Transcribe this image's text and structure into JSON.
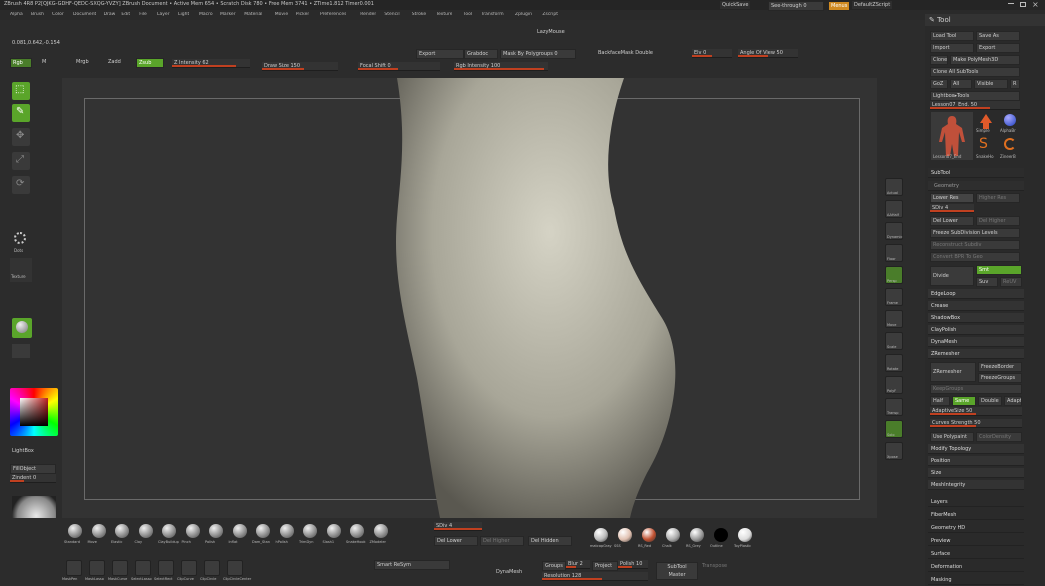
{
  "app": {
    "title": "ZBrush 4R8 P2[QJKG-GDHF-QEDC-SXQG-YVZY]  ZBrush Document   • Active Mem 654 • Scratch Disk 780 • Free Mem 3741 • ZTime1.812 Timer0.001",
    "quicksave": "QuickSave",
    "see_through": "See-through 0",
    "menus_btn": "Menus",
    "script": "DefaultZScript"
  },
  "menus": [
    "Alpha",
    "Brush",
    "Color",
    "Document",
    "Draw",
    "Edit",
    "File",
    "Layer",
    "Light",
    "Macro",
    "Marker",
    "Material",
    "Movie",
    "Picker",
    "Preferences",
    "Render",
    "Stencil",
    "Stroke",
    "Texture",
    "Tool",
    "Transform",
    "Zplugin",
    "Zscript"
  ],
  "coords": "0.081,0.642,-0.154",
  "toolbar": {
    "lazymouse": "LazyMouse",
    "export": "Export",
    "grabdoc": "Grabdoc",
    "mask_by_polygroups": "Mask By Polygroups 0",
    "backfacemask": "BackfaceMask Double",
    "elv": "Elv 0",
    "angle_of_view": "Angle Of View 50",
    "rgb": "Rgb",
    "m": "M",
    "mrgb": "Mrgb",
    "zadd": "Zadd",
    "zsub": "Zsub",
    "zcut": "Zcut",
    "z_intensity": "Z Intensity 62",
    "draw_size": "Draw Size 150",
    "focal_shift": "Focal Shift 0",
    "rgb_intensity": "Rgb Intensity 100"
  },
  "left_tools": [
    {
      "label": "Edit"
    },
    {
      "label": "Draw"
    },
    {
      "label": "Move"
    },
    {
      "label": "Scale"
    },
    {
      "label": "Rotate"
    }
  ],
  "left_panel": {
    "dots": "Dots",
    "texture": "Texture",
    "gold": "Gold",
    "lightbox": "LightBox",
    "fill_object": "FillObject",
    "zindent": "Zindent 0",
    "alpha": "Alpha"
  },
  "right_tool": {
    "header": "Tool",
    "load_tool": "Load Tool",
    "save_as": "Save As",
    "import": "Import",
    "export": "Export",
    "clone": "Clone",
    "make_polymesh": "Make PolyMesh3D",
    "clone_all": "Clone All SubTools",
    "goz": "GoZ",
    "all": "All",
    "visible": "Visible",
    "r": "R",
    "lightbox_tools": "Lightbox▸Tools",
    "tool_name": "Lesson07_End. 50",
    "thumb_labels": [
      "Lesson07_End",
      "Simple",
      "AlphaBr",
      "SnakeHo",
      "ZineerB"
    ],
    "subtool": "SubTool",
    "geometry": "Geometry",
    "lower_res": "Lower Res",
    "higher_res": "Higher Res",
    "sdiv": "SDiv 4",
    "del_lower": "Del Lower",
    "del_higher": "Del Higher",
    "freeze_subdiv": "Freeze SubDivision Levels",
    "reconstruct": "Reconstruct Subdiv",
    "convert_bpr": "Convert BPR To Geo",
    "divide": "Divide",
    "smt": "Smt",
    "suv": "Suv",
    "reuv": "ReUV",
    "edgeloop": "EdgeLoop",
    "crease": "Crease",
    "shadowbox": "ShadowBox",
    "claypolish": "ClayPolish",
    "dynamesh": "DynaMesh",
    "zremesher": "ZRemesher",
    "zremesher_btn": "ZRemesher",
    "freeze_border": "FreezeBorder",
    "freeze_groups": "FreezeGroups",
    "keep_groups": "KeepGroups",
    "half": "Half",
    "same": "Same",
    "double": "Double",
    "adapt": "Adapt",
    "adaptive_size": "AdaptiveSize 50",
    "curves_strength": "Curves Strength 50",
    "use_polypaint": "Use Polypaint",
    "color_density": "ColorDensity",
    "modify_topology": "Modify Topology",
    "position": "Position",
    "size": "Size",
    "mesh_integrity": "MeshIntegrity",
    "layers": "Layers",
    "fibermesh": "FiberMesh",
    "geometry_hd": "Geometry HD",
    "preview": "Preview",
    "surface": "Surface",
    "deformation": "Deformation",
    "masking": "Masking"
  },
  "right_dock": [
    "Actual",
    "AAHalf",
    "Dynamic",
    "Floor",
    "Persp",
    "Frame",
    "Move",
    "Scale",
    "Rotate",
    "PolyF",
    "Transp",
    "Solo",
    "Xpose"
  ],
  "bottom": {
    "brushes": [
      "Standard",
      "Move",
      "Elastic",
      "Clay",
      "ClayBuildup",
      "Pinch",
      "Polish",
      "Inflat",
      "Dam_Stan",
      "hPolish",
      "TrimDyn",
      "Slash1",
      "SnakeHook",
      "ZModeler"
    ],
    "sdiv": "SDiv 4",
    "del_lower": "Del Lower",
    "del_higher": "Del Higher",
    "del_hidden": "Del Hidden",
    "materials": [
      "matcapGray",
      "SSS",
      "RS_Red",
      "Chalk",
      "RS_Grey",
      "Outline",
      "ToyPlastic"
    ],
    "row2": [
      "MaskPen",
      "MaskLasso",
      "MaskCurve",
      "SelectLasso",
      "SelectRect",
      "ClipCurve",
      "ClipCircle",
      "ClipCircleCenter"
    ],
    "smart_resym": "Smart ReSym",
    "dynamesh": "DynaMesh",
    "groups": "Groups",
    "blur": "Blur 2",
    "project": "Project",
    "polish": "Polish 10",
    "resolution": "Resolution 128",
    "subtool_master": "SubTool Master",
    "transpose": "Transpose"
  },
  "colors": {
    "accent": "#5aa52a",
    "slider": "#c04020",
    "canvas": "#333333",
    "mesh": "#b8b6a8"
  }
}
